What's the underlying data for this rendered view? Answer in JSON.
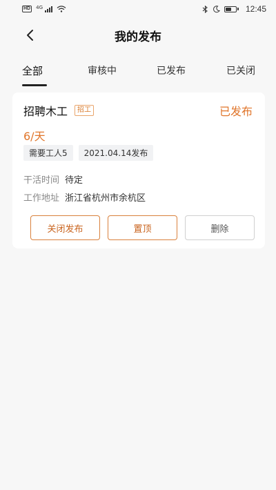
{
  "status_bar": {
    "network_type": "4G",
    "time": "12:45"
  },
  "header": {
    "title": "我的发布"
  },
  "tabs": [
    {
      "label": "全部",
      "active": true
    },
    {
      "label": "审核中",
      "active": false
    },
    {
      "label": "已发布",
      "active": false
    },
    {
      "label": "已关闭",
      "active": false
    }
  ],
  "post": {
    "title": "招聘木工",
    "tag": "招工",
    "status": "已发布",
    "wage": "6/天",
    "workers_needed": "需要工人5",
    "published_date": "2021.04.14发布",
    "work_time_label": "干活时间",
    "work_time_value": "待定",
    "address_label": "工作地址",
    "address_value": "浙江省杭州市余杭区",
    "actions": {
      "close_label": "关闭发布",
      "pin_label": "置顶",
      "delete_label": "删除"
    }
  },
  "colors": {
    "accent": "#e0752a",
    "background": "#f7f7f7",
    "card": "#ffffff"
  }
}
